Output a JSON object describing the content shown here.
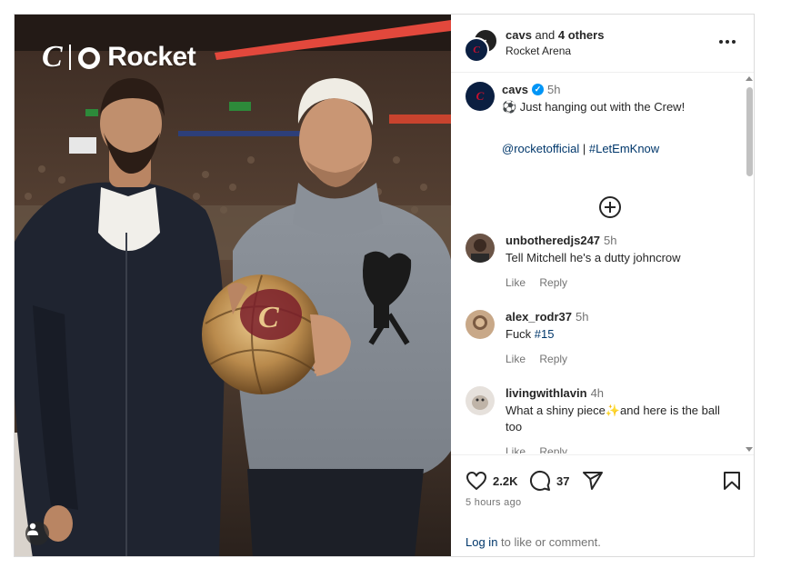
{
  "photo": {
    "brand_wordmark": "Rocket",
    "brand_mark": "C"
  },
  "header": {
    "account": "cavs",
    "joiner": "and",
    "others": "4 others",
    "location": "Rocket Arena"
  },
  "caption": {
    "username": "cavs",
    "time": "5h",
    "text": "⚽ Just hanging out with the Crew!",
    "mention": "@rocketofficial",
    "separator": "|",
    "hashtag": "#LetEmKnow"
  },
  "comments": [
    {
      "username": "unbotheredjs247",
      "time": "5h",
      "text": "Tell Mitchell he's a dutty johncrow",
      "like": "Like",
      "reply": "Reply"
    },
    {
      "username": "alex_rodr37",
      "time": "5h",
      "text_prefix": "Fuck ",
      "hashtag": "#15",
      "like": "Like",
      "reply": "Reply"
    },
    {
      "username": "livingwithlavin",
      "time": "4h",
      "text": "What a shiny piece✨and here is the ball too",
      "like": "Like",
      "reply": "Reply"
    }
  ],
  "footer": {
    "likes": "2.2K",
    "comments": "37",
    "time_ago": "5 hours ago",
    "login_link": "Log in",
    "login_rest": " to like or comment."
  },
  "icons": {
    "like": "heart-icon",
    "comment": "comment-icon",
    "share": "share-icon",
    "save": "bookmark-icon",
    "more": "more-icon",
    "load_more": "plus-circle-icon",
    "user_tag": "user-icon"
  },
  "colors": {
    "link": "#00376b",
    "verified": "#0095f6",
    "cavs_navy": "#0b1f41",
    "cavs_wine": "#860038"
  }
}
